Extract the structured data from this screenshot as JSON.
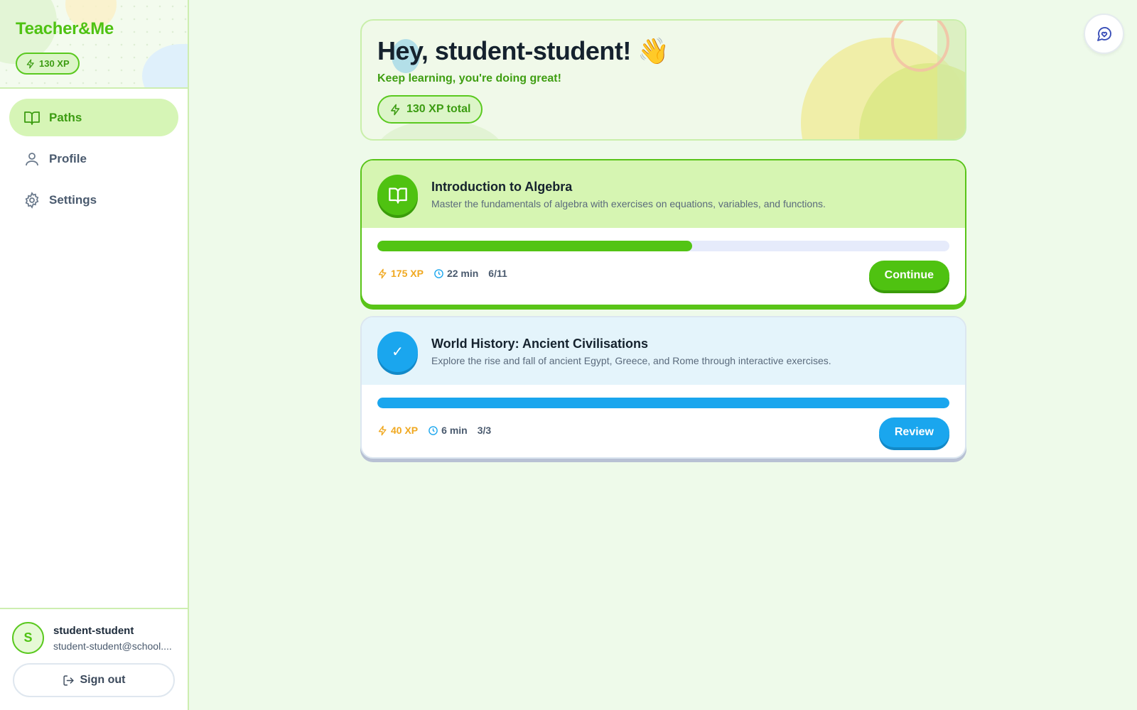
{
  "app": {
    "brand": "Teacher&Me",
    "xp_badge": "130 XP"
  },
  "nav": {
    "items": [
      {
        "label": "Paths",
        "icon": "book-icon",
        "active": true
      },
      {
        "label": "Profile",
        "icon": "user-icon",
        "active": false
      },
      {
        "label": "Settings",
        "icon": "gear-icon",
        "active": false
      }
    ]
  },
  "user": {
    "initial": "S",
    "name": "student-student",
    "email": "student-student@school....",
    "signout_label": "Sign out"
  },
  "hero": {
    "title": "Hey, student-student! 👋",
    "subtitle": "Keep learning, you're doing great!",
    "xp_total": "130 XP total"
  },
  "paths": [
    {
      "title": "Introduction to Algebra",
      "description": "Master the fundamentals of algebra with exercises on equations, variables, and functions.",
      "progress_fraction": 0.55,
      "xp": "175 XP",
      "time": "22 min",
      "count": "6/11",
      "button": "Continue",
      "status_icon": "book-icon"
    },
    {
      "title": "World History: Ancient Civilisations",
      "description": "Explore the rise and fall of ancient Egypt, Greece, and Rome through interactive exercises.",
      "progress_fraction": 1.0,
      "xp": "40 XP",
      "time": "6 min",
      "count": "3/3",
      "button": "Review",
      "status_icon": "check-icon",
      "status_glyph": "✓"
    }
  ],
  "colors": {
    "accent_green": "#4fc211",
    "accent_blue": "#1aa6ee",
    "xp_orange": "#f0a820",
    "page_bg": "#eefaea"
  }
}
